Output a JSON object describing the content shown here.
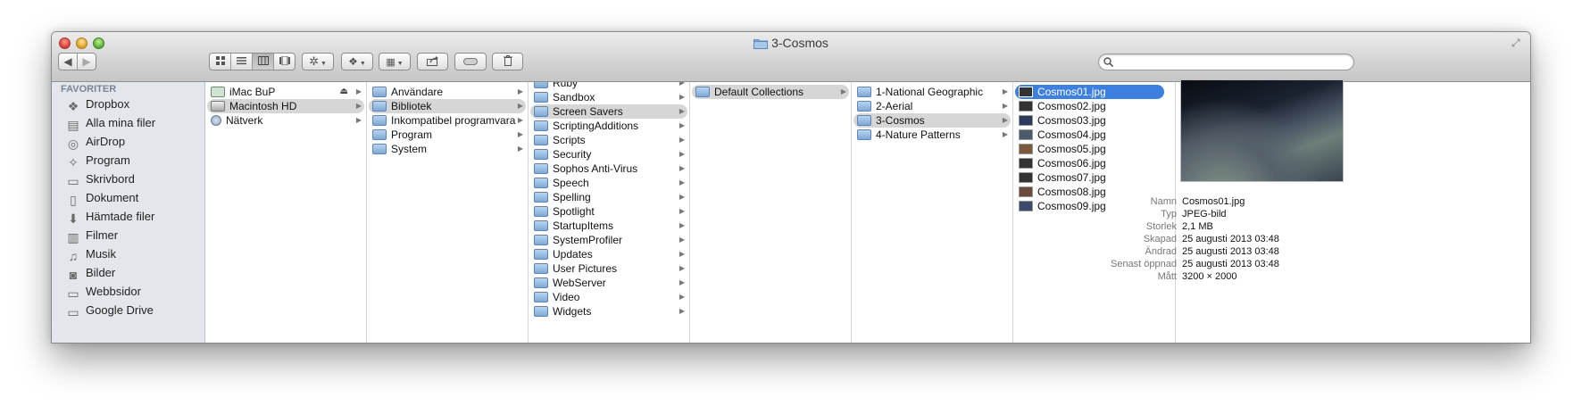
{
  "window": {
    "title": "3-Cosmos"
  },
  "toolbar": {
    "search_placeholder": ""
  },
  "sidebar": {
    "heading": "FAVORITER",
    "items": [
      {
        "label": "Dropbox",
        "icon": "dropbox-icon"
      },
      {
        "label": "Alla mina filer",
        "icon": "all-files-icon"
      },
      {
        "label": "AirDrop",
        "icon": "airdrop-icon"
      },
      {
        "label": "Program",
        "icon": "applications-icon"
      },
      {
        "label": "Skrivbord",
        "icon": "desktop-icon"
      },
      {
        "label": "Dokument",
        "icon": "documents-icon"
      },
      {
        "label": "Hämtade filer",
        "icon": "downloads-icon"
      },
      {
        "label": "Filmer",
        "icon": "movies-icon"
      },
      {
        "label": "Musik",
        "icon": "music-icon"
      },
      {
        "label": "Bilder",
        "icon": "pictures-icon"
      },
      {
        "label": "Webbsidor",
        "icon": "folder-icon"
      },
      {
        "label": "Google Drive",
        "icon": "folder-icon"
      }
    ]
  },
  "columns": {
    "devices": [
      {
        "label": "iMac BuP",
        "eject": "⏏"
      },
      {
        "label": "Macintosh HD",
        "selected": true
      },
      {
        "label": "Nätverk"
      }
    ],
    "hd": [
      {
        "label": "Användare"
      },
      {
        "label": "Bibliotek",
        "selected": true
      },
      {
        "label": "Inkompatibel programvara"
      },
      {
        "label": "Program"
      },
      {
        "label": "System"
      }
    ],
    "library": [
      {
        "label": "Ruby"
      },
      {
        "label": "Sandbox"
      },
      {
        "label": "Screen Savers",
        "selected": true
      },
      {
        "label": "ScriptingAdditions"
      },
      {
        "label": "Scripts"
      },
      {
        "label": "Security"
      },
      {
        "label": "Sophos Anti-Virus"
      },
      {
        "label": "Speech"
      },
      {
        "label": "Spelling"
      },
      {
        "label": "Spotlight"
      },
      {
        "label": "StartupItems"
      },
      {
        "label": "SystemProfiler"
      },
      {
        "label": "Updates"
      },
      {
        "label": "User Pictures"
      },
      {
        "label": "WebServer"
      },
      {
        "label": "Video"
      },
      {
        "label": "Widgets"
      }
    ],
    "screensavers": [
      {
        "label": "Default Collections",
        "selected": true
      }
    ],
    "collections": [
      {
        "label": "1-National Geographic"
      },
      {
        "label": "2-Aerial"
      },
      {
        "label": "3-Cosmos",
        "selected": true
      },
      {
        "label": "4-Nature Patterns"
      }
    ],
    "files": [
      {
        "label": "Cosmos01.jpg",
        "selected": true
      },
      {
        "label": "Cosmos02.jpg"
      },
      {
        "label": "Cosmos03.jpg"
      },
      {
        "label": "Cosmos04.jpg"
      },
      {
        "label": "Cosmos05.jpg"
      },
      {
        "label": "Cosmos06.jpg"
      },
      {
        "label": "Cosmos07.jpg"
      },
      {
        "label": "Cosmos08.jpg"
      },
      {
        "label": "Cosmos09.jpg"
      }
    ]
  },
  "preview": {
    "meta": [
      {
        "key": "Namn",
        "value": "Cosmos01.jpg"
      },
      {
        "key": "Typ",
        "value": "JPEG-bild"
      },
      {
        "key": "Storlek",
        "value": "2,1 MB"
      },
      {
        "key": "Skapad",
        "value": "25 augusti 2013 03:48"
      },
      {
        "key": "Ändrad",
        "value": "25 augusti 2013 03:48"
      },
      {
        "key": "Senast öppnad",
        "value": "25 augusti 2013 03:48"
      },
      {
        "key": "Mått",
        "value": "3200 × 2000"
      }
    ]
  },
  "colors": {
    "selection_blue": "#3d80df",
    "selection_gray": "#d6d6d6",
    "sidebar_bg": "#e3e7ec"
  }
}
